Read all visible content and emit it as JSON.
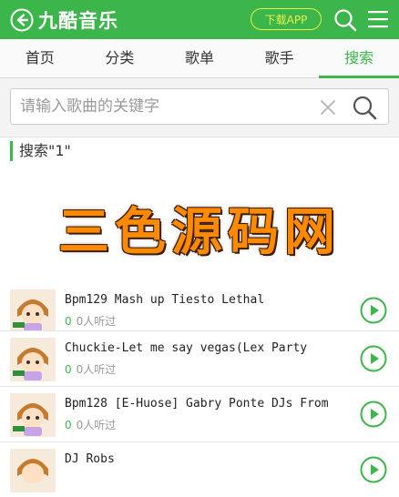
{
  "header": {
    "title": "九酷音乐",
    "download_label": "下载APP",
    "bg_color": "#3cb54a",
    "accent_color": "#e8f04a",
    "back_icon": "circle-arrow-left-icon",
    "search_icon": "search-icon",
    "menu_icon": "menu-icon"
  },
  "tabs": [
    {
      "label": "首页",
      "active": false
    },
    {
      "label": "分类",
      "active": false
    },
    {
      "label": "歌单",
      "active": false
    },
    {
      "label": "歌手",
      "active": false
    },
    {
      "label": "搜索",
      "active": true
    }
  ],
  "search": {
    "placeholder": "请输入歌曲的关键字",
    "value": "",
    "clear_icon": "close-icon",
    "submit_icon": "search-icon"
  },
  "results": {
    "heading": "搜索\"1\"",
    "items": [
      {
        "title": "Bpm129 Mash up Tiesto Lethal",
        "plays_count": "0",
        "plays_label": "0人听过"
      },
      {
        "title": "Chuckie-Let me say vegas(Lex Party",
        "plays_count": "0",
        "plays_label": "0人听过"
      },
      {
        "title": "Bpm128 [E-Huose] Gabry Ponte DJs From",
        "plays_count": "0",
        "plays_label": "0人听过"
      },
      {
        "title": "DJ Robs",
        "plays_count": "",
        "plays_label": ""
      }
    ]
  },
  "watermark": {
    "text": "三色源码网"
  }
}
